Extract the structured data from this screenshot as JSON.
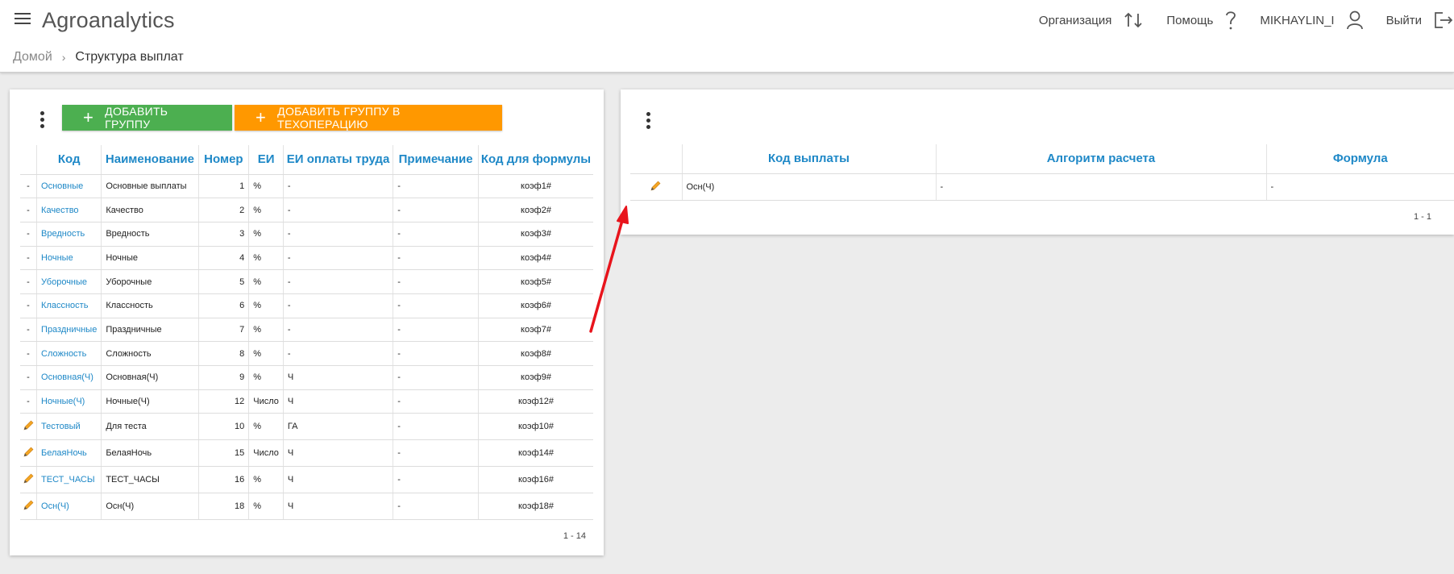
{
  "app": {
    "title": "Agroanalytics"
  },
  "top_actions": {
    "organization": "Организация",
    "help": "Помощь",
    "user": "MIKHAYLIN_I",
    "logout": "Выйти"
  },
  "breadcrumb": {
    "home": "Домой",
    "current": "Структура выплат"
  },
  "left_panel": {
    "add_group_label": "ДОБАВИТЬ ГРУППУ",
    "add_group_tech_label": "ДОБАВИТЬ ГРУППУ В ТЕХОПЕРАЦИЮ",
    "columns": [
      "Код",
      "Наименование",
      "Номер",
      "ЕИ",
      "ЕИ оплаты труда",
      "Примечание",
      "Код для формулы"
    ],
    "rows": [
      {
        "action": "-",
        "code": "Основные",
        "name": "Основные выплаты",
        "num": "1",
        "ei": "%",
        "ei_pay": "-",
        "note": "-",
        "formula": "коэф1#"
      },
      {
        "action": "-",
        "code": "Качество",
        "name": "Качество",
        "num": "2",
        "ei": "%",
        "ei_pay": "-",
        "note": "-",
        "formula": "коэф2#"
      },
      {
        "action": "-",
        "code": "Вредность",
        "name": "Вредность",
        "num": "3",
        "ei": "%",
        "ei_pay": "-",
        "note": "-",
        "formula": "коэф3#"
      },
      {
        "action": "-",
        "code": "Ночные",
        "name": "Ночные",
        "num": "4",
        "ei": "%",
        "ei_pay": "-",
        "note": "-",
        "formula": "коэф4#"
      },
      {
        "action": "-",
        "code": "Уборочные",
        "name": "Уборочные",
        "num": "5",
        "ei": "%",
        "ei_pay": "-",
        "note": "-",
        "formula": "коэф5#"
      },
      {
        "action": "-",
        "code": "Классность",
        "name": "Классность",
        "num": "6",
        "ei": "%",
        "ei_pay": "-",
        "note": "-",
        "formula": "коэф6#"
      },
      {
        "action": "-",
        "code": "Праздничные",
        "name": "Праздничные",
        "num": "7",
        "ei": "%",
        "ei_pay": "-",
        "note": "-",
        "formula": "коэф7#"
      },
      {
        "action": "-",
        "code": "Сложность",
        "name": "Сложность",
        "num": "8",
        "ei": "%",
        "ei_pay": "-",
        "note": "-",
        "formula": "коэф8#"
      },
      {
        "action": "-",
        "code": "Основная(Ч)",
        "name": "Основная(Ч)",
        "num": "9",
        "ei": "%",
        "ei_pay": "Ч",
        "note": "-",
        "formula": "коэф9#"
      },
      {
        "action": "-",
        "code": "Ночные(Ч)",
        "name": "Ночные(Ч)",
        "num": "12",
        "ei": "Число",
        "ei_pay": "Ч",
        "note": "-",
        "formula": "коэф12#"
      },
      {
        "action": "pencil-icon",
        "code": "Тестовый",
        "name": "Для теста",
        "num": "10",
        "ei": "%",
        "ei_pay": "ГА",
        "note": "-",
        "formula": "коэф10#"
      },
      {
        "action": "pencil-icon",
        "code": "БелаяНочь",
        "name": "БелаяНочь",
        "num": "15",
        "ei": "Число",
        "ei_pay": "Ч",
        "note": "-",
        "formula": "коэф14#"
      },
      {
        "action": "pencil-icon",
        "code": "ТЕСТ_ЧАСЫ",
        "name": "ТЕСТ_ЧАСЫ",
        "num": "16",
        "ei": "%",
        "ei_pay": "Ч",
        "note": "-",
        "formula": "коэф16#"
      },
      {
        "action": "pencil-icon",
        "code": "Осн(Ч)",
        "name": "Осн(Ч)",
        "num": "18",
        "ei": "%",
        "ei_pay": "Ч",
        "note": "-",
        "formula": "коэф18#"
      }
    ],
    "pager": "1 - 14"
  },
  "right_panel": {
    "columns": [
      "Код выплаты",
      "Алгоритм расчета",
      "Формула"
    ],
    "rows": [
      {
        "action": "pencil-icon",
        "code": "Осн(Ч)",
        "algorithm": "-",
        "formula": "-"
      }
    ],
    "pager": "1 - 1"
  },
  "colors": {
    "accent": "#1e88c7",
    "green": "#4caf50",
    "orange": "#ff9800",
    "annotation": "#e8141c"
  }
}
